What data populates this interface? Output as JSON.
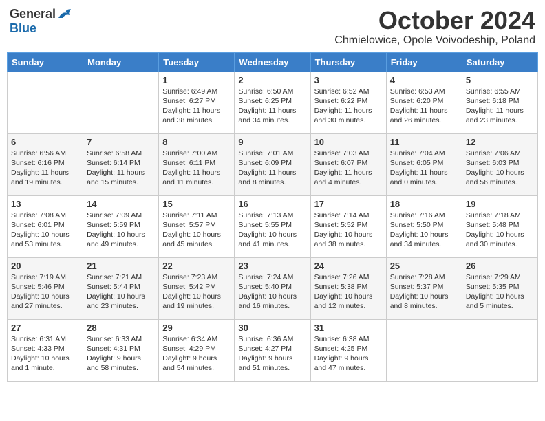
{
  "logo": {
    "general": "General",
    "blue": "Blue"
  },
  "title": "October 2024",
  "subtitle": "Chmielowice, Opole Voivodeship, Poland",
  "days_of_week": [
    "Sunday",
    "Monday",
    "Tuesday",
    "Wednesday",
    "Thursday",
    "Friday",
    "Saturday"
  ],
  "weeks": [
    [
      {
        "day": "",
        "sunrise": "",
        "sunset": "",
        "daylight": ""
      },
      {
        "day": "",
        "sunrise": "",
        "sunset": "",
        "daylight": ""
      },
      {
        "day": "1",
        "sunrise": "Sunrise: 6:49 AM",
        "sunset": "Sunset: 6:27 PM",
        "daylight": "Daylight: 11 hours and 38 minutes."
      },
      {
        "day": "2",
        "sunrise": "Sunrise: 6:50 AM",
        "sunset": "Sunset: 6:25 PM",
        "daylight": "Daylight: 11 hours and 34 minutes."
      },
      {
        "day": "3",
        "sunrise": "Sunrise: 6:52 AM",
        "sunset": "Sunset: 6:22 PM",
        "daylight": "Daylight: 11 hours and 30 minutes."
      },
      {
        "day": "4",
        "sunrise": "Sunrise: 6:53 AM",
        "sunset": "Sunset: 6:20 PM",
        "daylight": "Daylight: 11 hours and 26 minutes."
      },
      {
        "day": "5",
        "sunrise": "Sunrise: 6:55 AM",
        "sunset": "Sunset: 6:18 PM",
        "daylight": "Daylight: 11 hours and 23 minutes."
      }
    ],
    [
      {
        "day": "6",
        "sunrise": "Sunrise: 6:56 AM",
        "sunset": "Sunset: 6:16 PM",
        "daylight": "Daylight: 11 hours and 19 minutes."
      },
      {
        "day": "7",
        "sunrise": "Sunrise: 6:58 AM",
        "sunset": "Sunset: 6:14 PM",
        "daylight": "Daylight: 11 hours and 15 minutes."
      },
      {
        "day": "8",
        "sunrise": "Sunrise: 7:00 AM",
        "sunset": "Sunset: 6:11 PM",
        "daylight": "Daylight: 11 hours and 11 minutes."
      },
      {
        "day": "9",
        "sunrise": "Sunrise: 7:01 AM",
        "sunset": "Sunset: 6:09 PM",
        "daylight": "Daylight: 11 hours and 8 minutes."
      },
      {
        "day": "10",
        "sunrise": "Sunrise: 7:03 AM",
        "sunset": "Sunset: 6:07 PM",
        "daylight": "Daylight: 11 hours and 4 minutes."
      },
      {
        "day": "11",
        "sunrise": "Sunrise: 7:04 AM",
        "sunset": "Sunset: 6:05 PM",
        "daylight": "Daylight: 11 hours and 0 minutes."
      },
      {
        "day": "12",
        "sunrise": "Sunrise: 7:06 AM",
        "sunset": "Sunset: 6:03 PM",
        "daylight": "Daylight: 10 hours and 56 minutes."
      }
    ],
    [
      {
        "day": "13",
        "sunrise": "Sunrise: 7:08 AM",
        "sunset": "Sunset: 6:01 PM",
        "daylight": "Daylight: 10 hours and 53 minutes."
      },
      {
        "day": "14",
        "sunrise": "Sunrise: 7:09 AM",
        "sunset": "Sunset: 5:59 PM",
        "daylight": "Daylight: 10 hours and 49 minutes."
      },
      {
        "day": "15",
        "sunrise": "Sunrise: 7:11 AM",
        "sunset": "Sunset: 5:57 PM",
        "daylight": "Daylight: 10 hours and 45 minutes."
      },
      {
        "day": "16",
        "sunrise": "Sunrise: 7:13 AM",
        "sunset": "Sunset: 5:55 PM",
        "daylight": "Daylight: 10 hours and 41 minutes."
      },
      {
        "day": "17",
        "sunrise": "Sunrise: 7:14 AM",
        "sunset": "Sunset: 5:52 PM",
        "daylight": "Daylight: 10 hours and 38 minutes."
      },
      {
        "day": "18",
        "sunrise": "Sunrise: 7:16 AM",
        "sunset": "Sunset: 5:50 PM",
        "daylight": "Daylight: 10 hours and 34 minutes."
      },
      {
        "day": "19",
        "sunrise": "Sunrise: 7:18 AM",
        "sunset": "Sunset: 5:48 PM",
        "daylight": "Daylight: 10 hours and 30 minutes."
      }
    ],
    [
      {
        "day": "20",
        "sunrise": "Sunrise: 7:19 AM",
        "sunset": "Sunset: 5:46 PM",
        "daylight": "Daylight: 10 hours and 27 minutes."
      },
      {
        "day": "21",
        "sunrise": "Sunrise: 7:21 AM",
        "sunset": "Sunset: 5:44 PM",
        "daylight": "Daylight: 10 hours and 23 minutes."
      },
      {
        "day": "22",
        "sunrise": "Sunrise: 7:23 AM",
        "sunset": "Sunset: 5:42 PM",
        "daylight": "Daylight: 10 hours and 19 minutes."
      },
      {
        "day": "23",
        "sunrise": "Sunrise: 7:24 AM",
        "sunset": "Sunset: 5:40 PM",
        "daylight": "Daylight: 10 hours and 16 minutes."
      },
      {
        "day": "24",
        "sunrise": "Sunrise: 7:26 AM",
        "sunset": "Sunset: 5:38 PM",
        "daylight": "Daylight: 10 hours and 12 minutes."
      },
      {
        "day": "25",
        "sunrise": "Sunrise: 7:28 AM",
        "sunset": "Sunset: 5:37 PM",
        "daylight": "Daylight: 10 hours and 8 minutes."
      },
      {
        "day": "26",
        "sunrise": "Sunrise: 7:29 AM",
        "sunset": "Sunset: 5:35 PM",
        "daylight": "Daylight: 10 hours and 5 minutes."
      }
    ],
    [
      {
        "day": "27",
        "sunrise": "Sunrise: 6:31 AM",
        "sunset": "Sunset: 4:33 PM",
        "daylight": "Daylight: 10 hours and 1 minute."
      },
      {
        "day": "28",
        "sunrise": "Sunrise: 6:33 AM",
        "sunset": "Sunset: 4:31 PM",
        "daylight": "Daylight: 9 hours and 58 minutes."
      },
      {
        "day": "29",
        "sunrise": "Sunrise: 6:34 AM",
        "sunset": "Sunset: 4:29 PM",
        "daylight": "Daylight: 9 hours and 54 minutes."
      },
      {
        "day": "30",
        "sunrise": "Sunrise: 6:36 AM",
        "sunset": "Sunset: 4:27 PM",
        "daylight": "Daylight: 9 hours and 51 minutes."
      },
      {
        "day": "31",
        "sunrise": "Sunrise: 6:38 AM",
        "sunset": "Sunset: 4:25 PM",
        "daylight": "Daylight: 9 hours and 47 minutes."
      },
      {
        "day": "",
        "sunrise": "",
        "sunset": "",
        "daylight": ""
      },
      {
        "day": "",
        "sunrise": "",
        "sunset": "",
        "daylight": ""
      }
    ]
  ]
}
